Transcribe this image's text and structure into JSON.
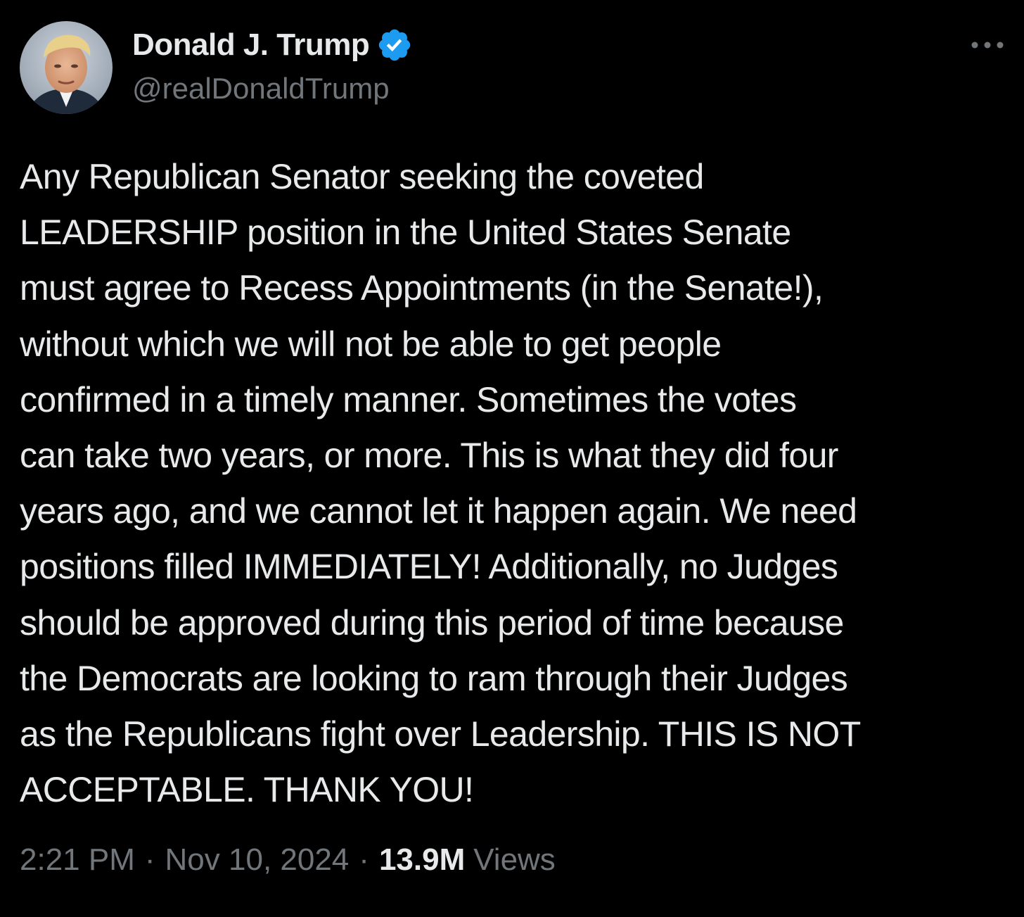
{
  "author": {
    "display_name": "Donald J. Trump",
    "handle": "@realDonaldTrump",
    "verified": true,
    "verified_color": "#1d9bf0"
  },
  "tweet": {
    "lines": [
      "Any Republican Senator seeking the coveted",
      "LEADERSHIP position in the United States Senate",
      "must agree to Recess Appointments (in the Senate!),",
      "without which we will not be able to get people",
      "confirmed in a timely manner. Sometimes the votes",
      "can take two years, or more. This is what they did four",
      "years ago, and we cannot let it happen again. We need",
      "positions filled IMMEDIATELY! Additionally, no Judges",
      "should be approved during this period of time because",
      "the Democrats are looking to ram through their Judges",
      "as the Republicans fight over Leadership. THIS IS NOT",
      "ACCEPTABLE. THANK YOU!"
    ]
  },
  "meta": {
    "time": "2:21 PM",
    "date": "Nov 10, 2024",
    "views_count": "13.9M",
    "views_label": "Views",
    "separator": "·"
  },
  "icons": {
    "avatar": "profile-photo",
    "verified": "verified-badge-icon",
    "more": "more-options-icon"
  },
  "colors": {
    "background": "#000000",
    "text_primary": "#e7e9ea",
    "text_secondary": "#71767b"
  }
}
